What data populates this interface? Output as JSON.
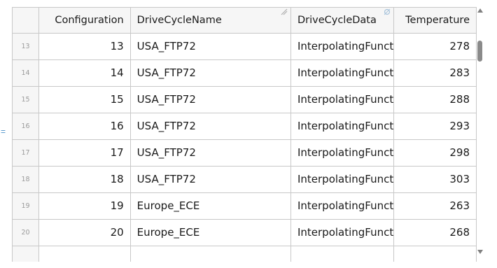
{
  "marker": "=",
  "columns": {
    "configuration": "Configuration",
    "drive_cycle_name": "DriveCycleName",
    "drive_cycle_data": "DriveCycleData",
    "temperature": "Temperature"
  },
  "rows": [
    {
      "index": "13",
      "configuration": "13",
      "drive_cycle_name": "USA_FTP72",
      "drive_cycle_data": "InterpolatingFunct",
      "temperature": "278"
    },
    {
      "index": "14",
      "configuration": "14",
      "drive_cycle_name": "USA_FTP72",
      "drive_cycle_data": "InterpolatingFunct",
      "temperature": "283"
    },
    {
      "index": "15",
      "configuration": "15",
      "drive_cycle_name": "USA_FTP72",
      "drive_cycle_data": "InterpolatingFunct",
      "temperature": "288"
    },
    {
      "index": "16",
      "configuration": "16",
      "drive_cycle_name": "USA_FTP72",
      "drive_cycle_data": "InterpolatingFunct",
      "temperature": "293"
    },
    {
      "index": "17",
      "configuration": "17",
      "drive_cycle_name": "USA_FTP72",
      "drive_cycle_data": "InterpolatingFunct",
      "temperature": "298"
    },
    {
      "index": "18",
      "configuration": "18",
      "drive_cycle_name": "USA_FTP72",
      "drive_cycle_data": "InterpolatingFunct",
      "temperature": "303"
    },
    {
      "index": "19",
      "configuration": "19",
      "drive_cycle_name": "Europe_ECE",
      "drive_cycle_data": "InterpolatingFunct",
      "temperature": "263"
    },
    {
      "index": "20",
      "configuration": "20",
      "drive_cycle_name": "Europe_ECE",
      "drive_cycle_data": "InterpolatingFunct",
      "temperature": "268"
    },
    {
      "index": "",
      "configuration": "",
      "drive_cycle_name": "",
      "drive_cycle_data": "",
      "temperature": ""
    }
  ],
  "icons": {
    "drive_cycle_name_column": "text-column-icon",
    "drive_cycle_data_column": "function-column-icon",
    "scroll_up": "arrow-up-icon",
    "scroll_down": "arrow-down-icon"
  }
}
